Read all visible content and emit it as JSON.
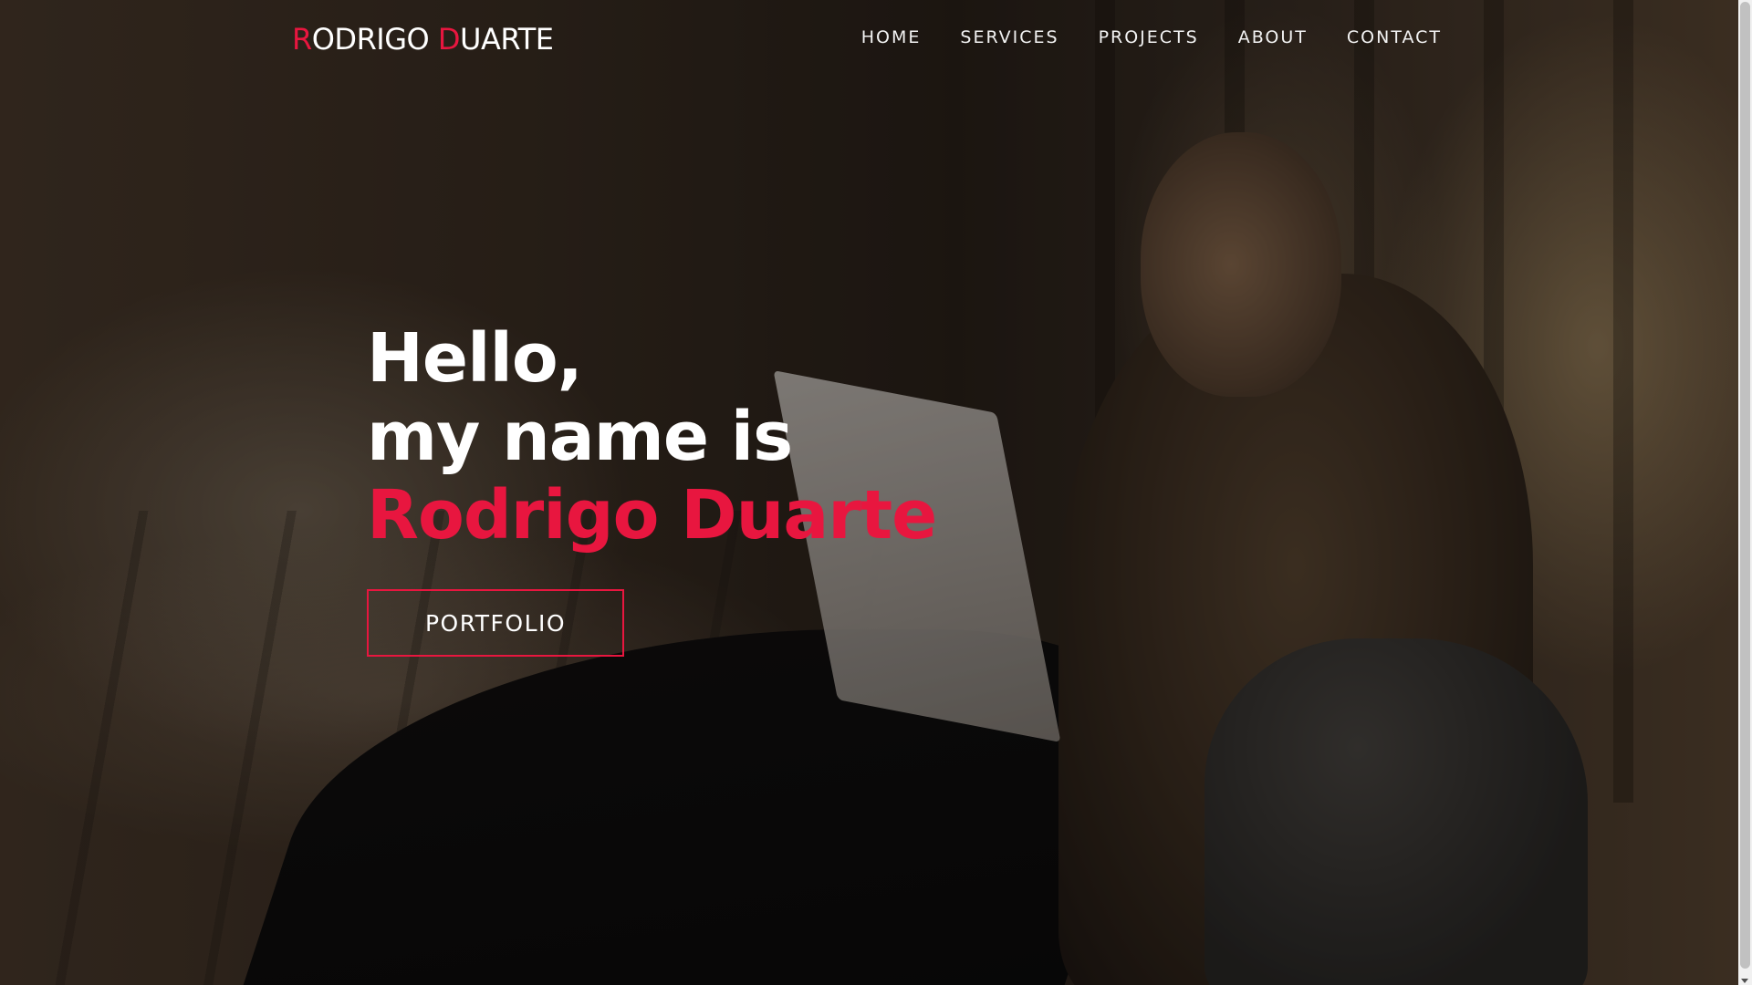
{
  "brand": {
    "first_initial": "R",
    "first_rest": "ODRIGO",
    "last_initial": "D",
    "last_rest": "UARTE"
  },
  "nav": {
    "items": [
      {
        "label": "HOME"
      },
      {
        "label": "SERVICES"
      },
      {
        "label": "PROJECTS"
      },
      {
        "label": "ABOUT"
      },
      {
        "label": "CONTACT"
      }
    ]
  },
  "hero": {
    "greeting": "Hello,",
    "intro": "my name is",
    "name": "Rodrigo Duarte",
    "cta_label": "PORTFOLIO"
  },
  "colors": {
    "accent": "#e8163f",
    "text": "#ffffff"
  }
}
